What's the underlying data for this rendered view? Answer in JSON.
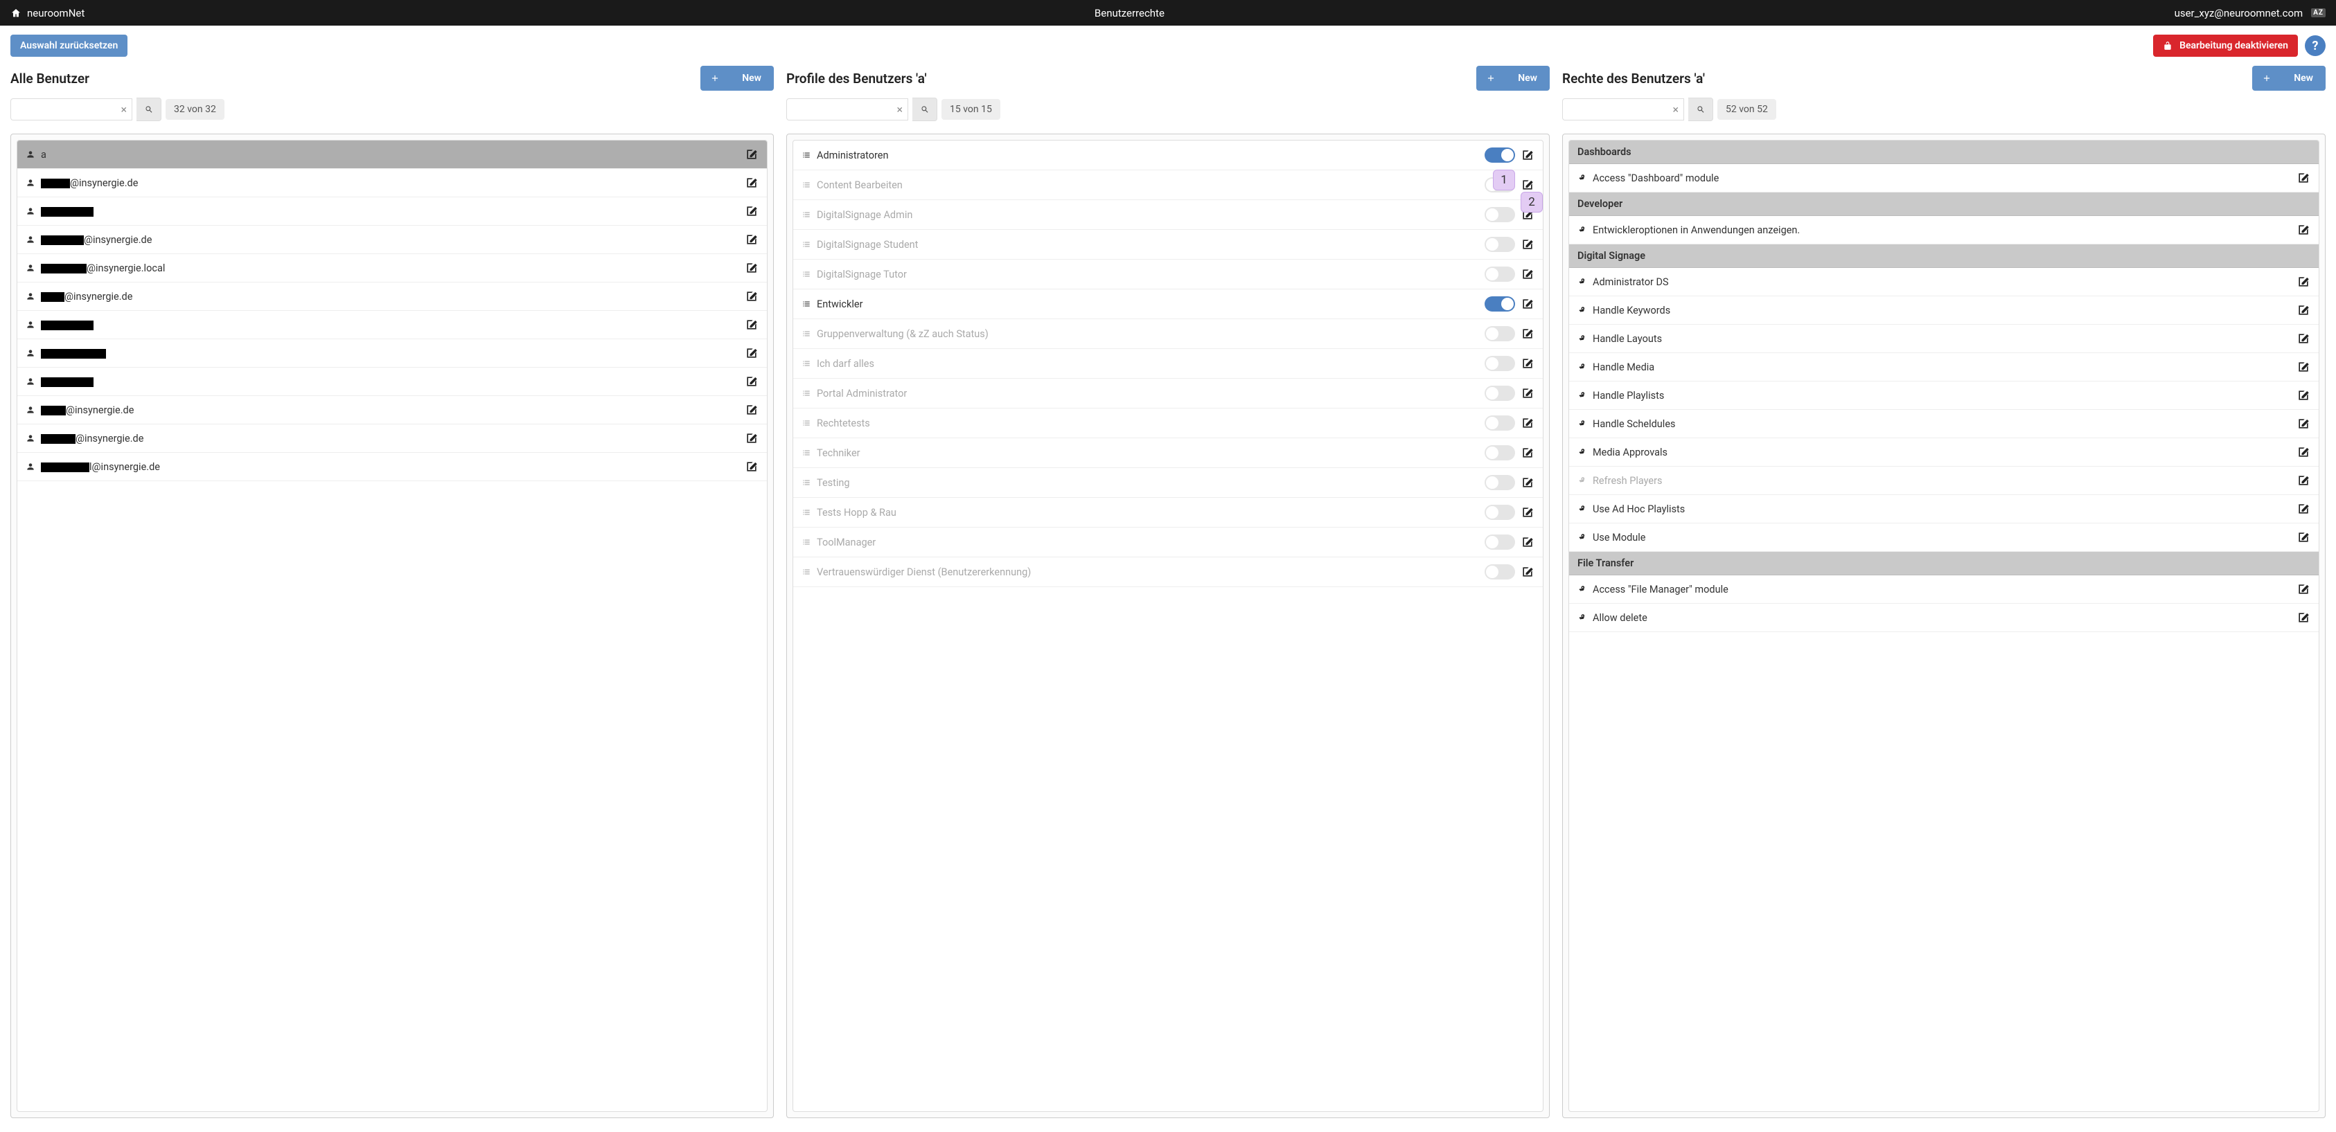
{
  "topbar": {
    "brand": "neuroomNet",
    "title": "Benutzerrechte",
    "user": "user_xyz@neuroomnet.com",
    "lang": "AZ"
  },
  "toolbar": {
    "reset": "Auswahl zurücksetzen",
    "disable_edit": "Bearbeitung deaktivieren"
  },
  "new_btn": "New",
  "users": {
    "title": "Alle Benutzer",
    "count": "32 von 32",
    "items": [
      {
        "pre": "",
        "w": 0,
        "post": "a",
        "selected": true
      },
      {
        "pre": "",
        "w": 42,
        "post": "@insynergie.de"
      },
      {
        "pre": "",
        "w": 76,
        "post": ""
      },
      {
        "pre": "",
        "w": 62,
        "post": "@insynergie.de"
      },
      {
        "pre": "",
        "w": 66,
        "post": "@insynergie.local"
      },
      {
        "pre": "",
        "w": 34,
        "post": "@insynergie.de"
      },
      {
        "pre": "",
        "w": 76,
        "post": ""
      },
      {
        "pre": "",
        "w": 94,
        "post": ""
      },
      {
        "pre": "",
        "w": 76,
        "post": ""
      },
      {
        "pre": "",
        "w": 36,
        "post": "@insynergie.de"
      },
      {
        "pre": "",
        "w": 50,
        "post": "@insynergie.de"
      },
      {
        "pre": "",
        "w": 70,
        "post": "l@insynergie.de"
      }
    ]
  },
  "profiles": {
    "title": "Profile des Benutzers 'a'",
    "count": "15 von 15",
    "callouts": {
      "1": "1",
      "2": "2"
    },
    "items": [
      {
        "label": "Administratoren",
        "on": true,
        "active": true
      },
      {
        "label": "Content Bearbeiten",
        "on": false,
        "active": false
      },
      {
        "label": "DigitalSignage Admin",
        "on": false,
        "active": false
      },
      {
        "label": "DigitalSignage Student",
        "on": false,
        "active": false
      },
      {
        "label": "DigitalSignage Tutor",
        "on": false,
        "active": false
      },
      {
        "label": "Entwickler",
        "on": true,
        "active": true
      },
      {
        "label": "Gruppenverwaltung (& zZ auch Status)",
        "on": false,
        "active": false
      },
      {
        "label": "Ich darf alles",
        "on": false,
        "active": false
      },
      {
        "label": "Portal Administrator",
        "on": false,
        "active": false
      },
      {
        "label": "Rechtetests",
        "on": false,
        "active": false
      },
      {
        "label": "Techniker",
        "on": false,
        "active": false
      },
      {
        "label": "Testing",
        "on": false,
        "active": false
      },
      {
        "label": "Tests Hopp & Rau",
        "on": false,
        "active": false
      },
      {
        "label": "ToolManager",
        "on": false,
        "active": false
      },
      {
        "label": "Vertrauenswürdiger Dienst (Benutzererkennung)",
        "on": false,
        "active": false
      }
    ]
  },
  "rights": {
    "title": "Rechte des Benutzers 'a'",
    "count": "52 von 52",
    "groups": [
      {
        "name": "Dashboards",
        "items": [
          {
            "label": "Access \"Dashboard\" module",
            "dim": false
          }
        ]
      },
      {
        "name": "Developer",
        "items": [
          {
            "label": "Entwickleroptionen in Anwendungen anzeigen.",
            "dim": false
          }
        ]
      },
      {
        "name": "Digital Signage",
        "items": [
          {
            "label": "Administrator DS",
            "dim": false
          },
          {
            "label": "Handle Keywords",
            "dim": false
          },
          {
            "label": "Handle Layouts",
            "dim": false
          },
          {
            "label": "Handle Media",
            "dim": false
          },
          {
            "label": "Handle Playlists",
            "dim": false
          },
          {
            "label": "Handle Scheldules",
            "dim": false
          },
          {
            "label": "Media Approvals",
            "dim": false
          },
          {
            "label": "Refresh Players",
            "dim": true
          },
          {
            "label": "Use Ad Hoc Playlists",
            "dim": false
          },
          {
            "label": "Use Module",
            "dim": false
          }
        ]
      },
      {
        "name": "File Transfer",
        "items": [
          {
            "label": "Access \"File Manager\" module",
            "dim": false
          },
          {
            "label": "Allow delete",
            "dim": false
          }
        ]
      }
    ]
  }
}
